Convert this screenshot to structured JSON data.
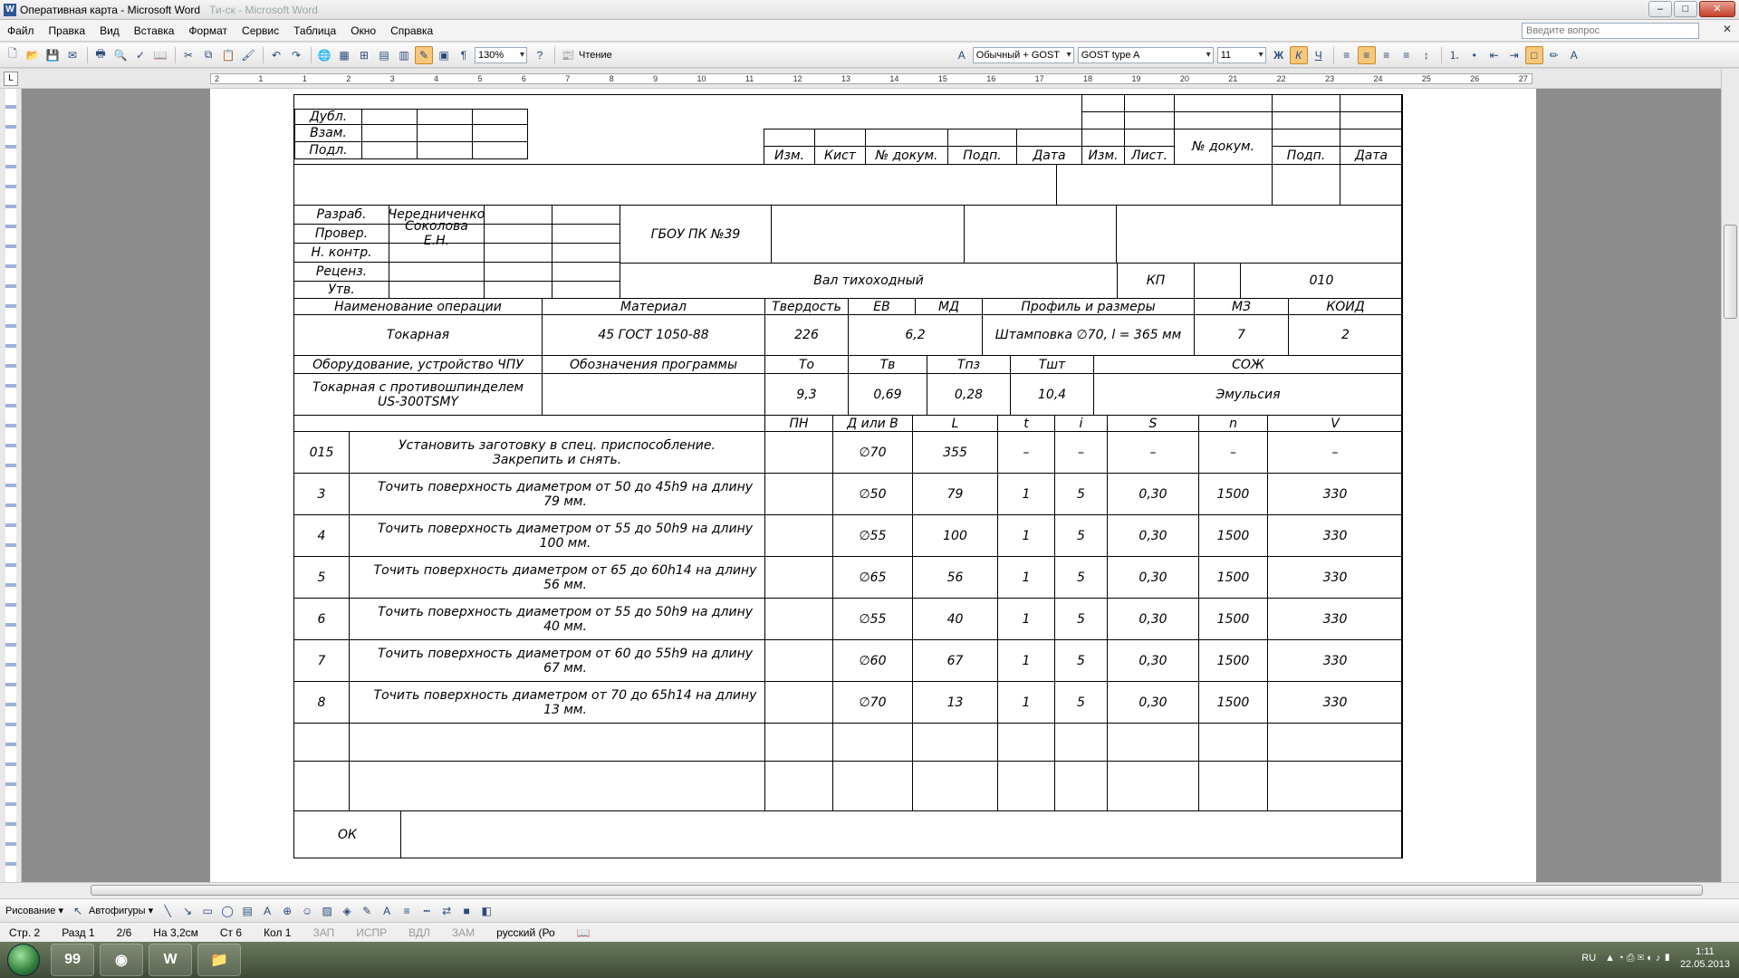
{
  "window": {
    "title": "Оперативная карта - Microsoft Word",
    "title_ghost": "Ти-ск - Microsoft Word",
    "controls": {
      "minimize": "–",
      "maximize": "□",
      "close": "✕"
    }
  },
  "menu": {
    "items": [
      "Файл",
      "Правка",
      "Вид",
      "Вставка",
      "Формат",
      "Сервис",
      "Таблица",
      "Окно",
      "Справка"
    ],
    "help_placeholder": "Введите вопрос",
    "close_doc": "✕"
  },
  "toolbar": {
    "zoom": "130%",
    "reading_label": "Чтение",
    "style": "Обычный + GOST",
    "font": "GOST type A",
    "font_size": "11",
    "bold": "Ж",
    "italic": "К",
    "underline": "Ч"
  },
  "ruler": {
    "corner": "L",
    "ticks": [
      "2",
      "1",
      "1",
      "2",
      "3",
      "4",
      "5",
      "6",
      "7",
      "8",
      "9",
      "10",
      "11",
      "12",
      "13",
      "14",
      "15",
      "16",
      "17",
      "18",
      "19",
      "20",
      "21",
      "22",
      "23",
      "24",
      "25",
      "26",
      "27"
    ]
  },
  "doc": {
    "head": {
      "dubl": "Дубл.",
      "vzam": "Взам.",
      "podl": "Подл.",
      "izm": "Изм.",
      "kist": "Кист",
      "ndoc": "№ докум.",
      "podp": "Подп.",
      "data": "Дата",
      "list": "Лист."
    },
    "people": {
      "razrab": "Разраб.",
      "razrab_name": "Чередниченко",
      "prover": "Провер.",
      "prover_name": "Соколова Е.Н.",
      "nkontr": "Н. контр.",
      "recenz": "Реценз.",
      "utv": "Утв."
    },
    "org": "ГБОУ ПК №39",
    "detail": "Вал тихоходный",
    "kp": "КП",
    "kp_value": "010",
    "mat_head": {
      "op_name": "Наименование операции",
      "material": "Материал",
      "hardness": "Твердость",
      "ev": "ЕВ",
      "md": "МД",
      "profile": "Профиль и размеры",
      "mz": "МЗ",
      "koid": "КОИД"
    },
    "mat_vals": {
      "op_name": "Токарная",
      "material": "45 ГОСТ 1050-88",
      "hardness": "226",
      "ev_md": "6,2",
      "profile": "Штамповка ∅70, l = 365 мм",
      "mz": "7",
      "koid": "2"
    },
    "equip_head": {
      "equip": "Оборудование, устройство ЧПУ",
      "program": "Обозначения программы",
      "to": "То",
      "tv": "Тв",
      "tpz": "Тпз",
      "tsht": "Тшт",
      "soj": "СОЖ"
    },
    "equip_vals": {
      "equip": "Токарная с противошпинделем\nUS-300TSMY",
      "to": "9,3",
      "tv": "0,69",
      "tpz": "0,28",
      "tsht": "10,4",
      "soj": "Эмульсия"
    },
    "col_head": {
      "pn": "ПН",
      "d": "Д или В",
      "l": "L",
      "t": "t",
      "i": "i",
      "s": "S",
      "n": "n",
      "v": "V"
    },
    "rows": [
      {
        "num": "015",
        "text": "Установить заготовку в спец. приспособление.\nЗакрепить и снять.",
        "pn": "",
        "d": "∅70",
        "l": "355",
        "t": "–",
        "i": "–",
        "s": "–",
        "n": "–",
        "v": "–"
      },
      {
        "num": "3",
        "text": "Точить поверхность диаметром от 50 до 45h9 на длину 79 мм.",
        "pn": "",
        "d": "∅50",
        "l": "79",
        "t": "1",
        "i": "5",
        "s": "0,30",
        "n": "1500",
        "v": "330"
      },
      {
        "num": "4",
        "text": "Точить поверхность диаметром от 55 до 50h9 на длину 100 мм.",
        "pn": "",
        "d": "∅55",
        "l": "100",
        "t": "1",
        "i": "5",
        "s": "0,30",
        "n": "1500",
        "v": "330"
      },
      {
        "num": "5",
        "text": "Точить поверхность диаметром от 65 до 60h14 на длину 56 мм.",
        "pn": "",
        "d": "∅65",
        "l": "56",
        "t": "1",
        "i": "5",
        "s": "0,30",
        "n": "1500",
        "v": "330"
      },
      {
        "num": "6",
        "text": "Точить поверхность диаметром от 55 до 50h9 на длину 40 мм.",
        "pn": "",
        "d": "∅55",
        "l": "40",
        "t": "1",
        "i": "5",
        "s": "0,30",
        "n": "1500",
        "v": "330"
      },
      {
        "num": "7",
        "text": "Точить поверхность диаметром от 60 до 55h9 на длину 67 мм.",
        "pn": "",
        "d": "∅60",
        "l": "67",
        "t": "1",
        "i": "5",
        "s": "0,30",
        "n": "1500",
        "v": "330"
      },
      {
        "num": "8",
        "text": "Точить поверхность диаметром от 70 до 65h14 на длину 13 мм.",
        "pn": "",
        "d": "∅70",
        "l": "13",
        "t": "1",
        "i": "5",
        "s": "0,30",
        "n": "1500",
        "v": "330"
      },
      {
        "num": "",
        "text": "",
        "pn": "",
        "d": "",
        "l": "",
        "t": "",
        "i": "",
        "s": "",
        "n": "",
        "v": ""
      },
      {
        "num": "",
        "text": "",
        "pn": "",
        "d": "",
        "l": "",
        "t": "",
        "i": "",
        "s": "",
        "n": "",
        "v": ""
      }
    ],
    "ok": "ОК"
  },
  "drawbar": {
    "drawing": "Рисование ▾",
    "autoshapes": "Автофигуры ▾"
  },
  "status": {
    "page": "Стр. 2",
    "section": "Разд 1",
    "pages": "2/6",
    "position": "На 3,2см",
    "line": "Ст 6",
    "col": "Кол 1",
    "rec": "ЗАП",
    "trk": "ИСПР",
    "ext": "ВДЛ",
    "ovr": "ЗАМ",
    "lang": "русский (Ро"
  },
  "taskbar": {
    "lang": "RU",
    "time": "1:11",
    "date": "22.05.2013",
    "badge": "99"
  },
  "colors": {
    "doc_background": "#8c8c8c",
    "page": "#ffffff",
    "taskbar": "#4a5940"
  }
}
